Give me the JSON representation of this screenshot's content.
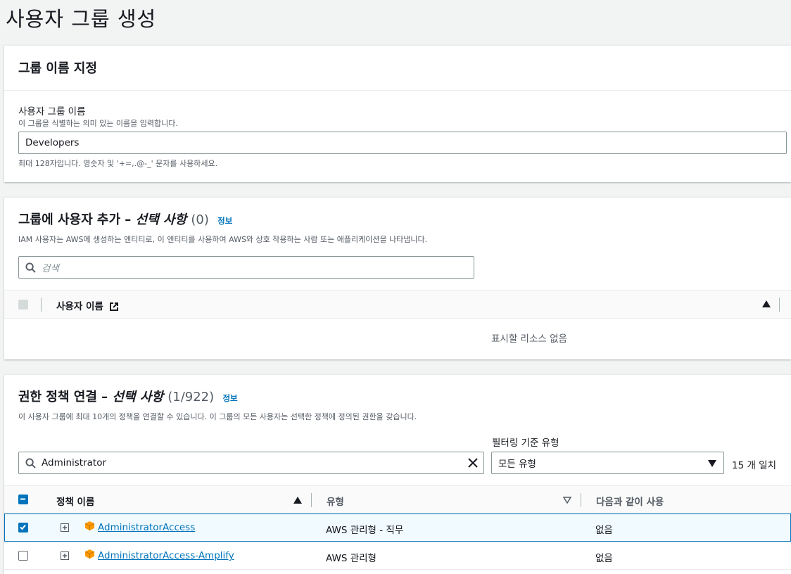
{
  "page": {
    "title": "사용자 그룹 생성"
  },
  "group_name_section": {
    "header": "그룹 이름 지정",
    "label": "사용자 그룹 이름",
    "description": "이 그룹을 식별하는 의미 있는 이름을 입력합니다.",
    "value": "Developers",
    "constraint": "최대 128자입니다. 영숫자 및 '+=,.@-_' 문자를 사용하세요."
  },
  "users_section": {
    "header_main": "그룹에 사용자 추가 – ",
    "header_italic": "선택 사항",
    "count": "(0)",
    "info": "정보",
    "description": "IAM 사용자는 AWS에 생성하는 엔티티로, 이 엔티티를 사용하여 AWS와 상호 작용하는 사람 또는 애플리케이션을 나타냅니다.",
    "search_placeholder": "검색",
    "column_user_name": "사용자 이름",
    "empty_text": "표시할 리소스 없음"
  },
  "policies_section": {
    "header_main": "권한 정책 연결 – ",
    "header_italic": "선택 사항",
    "count": "(1/922)",
    "info": "정보",
    "description": "이 사용자 그룹에 최대 10개의 정책을 연결할 수 있습니다. 이 그룹의 모든 사용자는 선택한 정책에 정의된 권한을 갖습니다.",
    "filter_label": "필터링 기준 유형",
    "search_value": "Administrator",
    "filter_value": "모든 유형",
    "match_count": "15 개 일치",
    "columns": {
      "name": "정책 이름",
      "type": "유형",
      "used_as": "다음과 같이 사용"
    },
    "rows": [
      {
        "name": "AdministratorAccess",
        "type": "AWS 관리형 - 직무",
        "used_as": "없음",
        "checked": true
      },
      {
        "name": "AdministratorAccess-Amplify",
        "type": "AWS 관리형",
        "used_as": "없음",
        "checked": false
      }
    ]
  },
  "colors": {
    "link": "#0073bb",
    "selected_row_bg": "#f1faff",
    "aws_box_icon": "#f90"
  }
}
